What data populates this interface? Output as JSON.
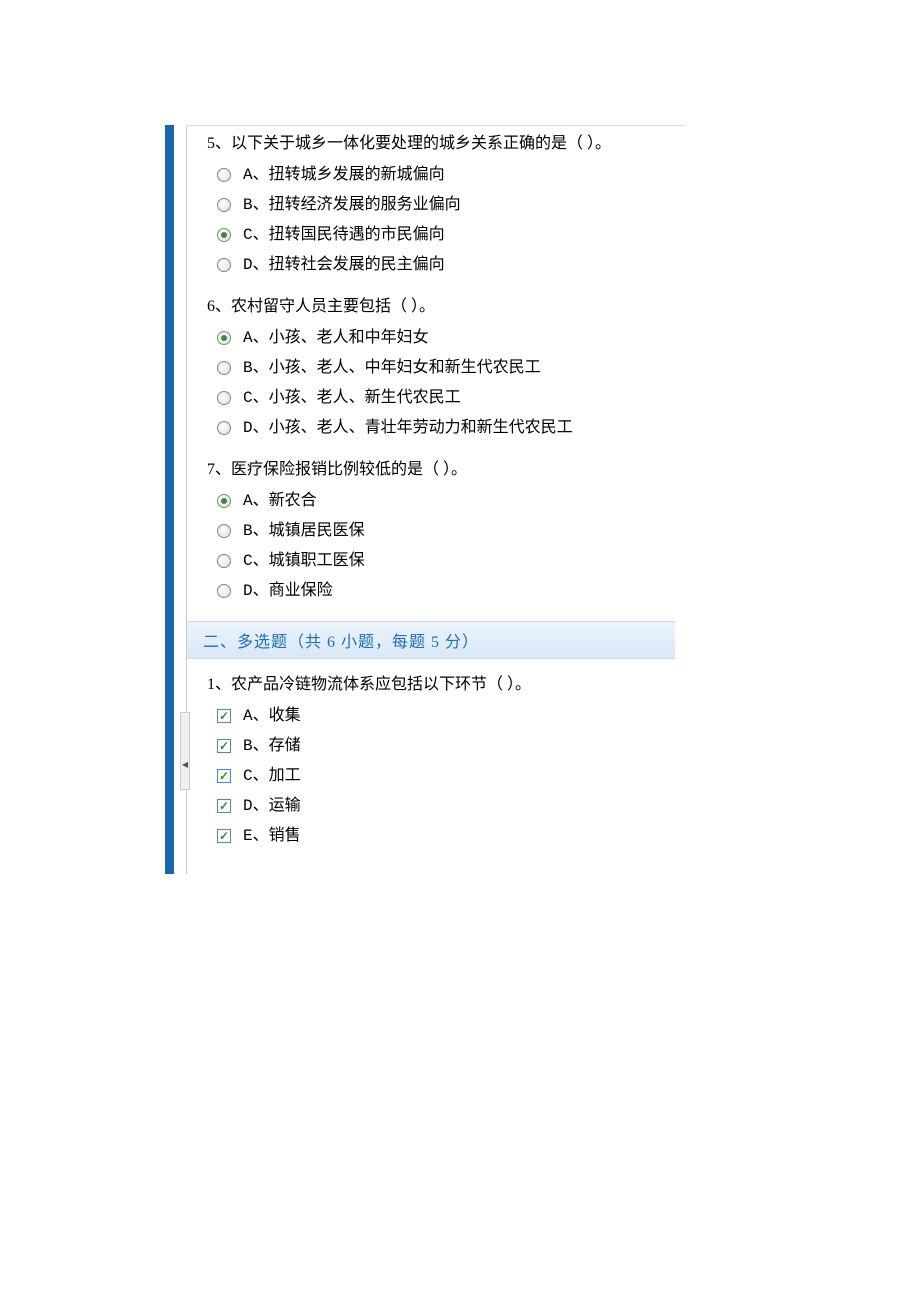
{
  "questions_single": [
    {
      "number": "5、",
      "text": "以下关于城乡一体化要处理的城乡关系正确的是（    ）。",
      "options": [
        {
          "letter": "A、",
          "text": "扭转城乡发展的新城偏向",
          "selected": false
        },
        {
          "letter": "B、",
          "text": "扭转经济发展的服务业偏向",
          "selected": false
        },
        {
          "letter": "C、",
          "text": "扭转国民待遇的市民偏向",
          "selected": true
        },
        {
          "letter": "D、",
          "text": "扭转社会发展的民主偏向",
          "selected": false
        }
      ]
    },
    {
      "number": "6、",
      "text": "农村留守人员主要包括（    ）。",
      "options": [
        {
          "letter": "A、",
          "text": "小孩、老人和中年妇女",
          "selected": true
        },
        {
          "letter": "B、",
          "text": "小孩、老人、中年妇女和新生代农民工",
          "selected": false
        },
        {
          "letter": "C、",
          "text": "小孩、老人、新生代农民工",
          "selected": false
        },
        {
          "letter": "D、",
          "text": "小孩、老人、青壮年劳动力和新生代农民工",
          "selected": false
        }
      ]
    },
    {
      "number": "7、",
      "text": "医疗保险报销比例较低的是（    ）。",
      "options": [
        {
          "letter": "A、",
          "text": "新农合",
          "selected": true
        },
        {
          "letter": "B、",
          "text": "城镇居民医保",
          "selected": false
        },
        {
          "letter": "C、",
          "text": "城镇职工医保",
          "selected": false
        },
        {
          "letter": "D、",
          "text": "商业保险",
          "selected": false
        }
      ]
    }
  ],
  "section2_title": "二、多选题（共 6 小题，每题 5 分）",
  "questions_multi": [
    {
      "number": "1、",
      "text": "农产品冷链物流体系应包括以下环节（    ）。",
      "options": [
        {
          "letter": "A、",
          "text": "收集",
          "checked": true
        },
        {
          "letter": "B、",
          "text": "存储",
          "checked": true
        },
        {
          "letter": "C、",
          "text": "加工",
          "checked": true
        },
        {
          "letter": "D、",
          "text": "运输",
          "checked": true
        },
        {
          "letter": "E、",
          "text": "销售",
          "checked": true
        }
      ]
    }
  ],
  "scroll_arrow": "◀"
}
